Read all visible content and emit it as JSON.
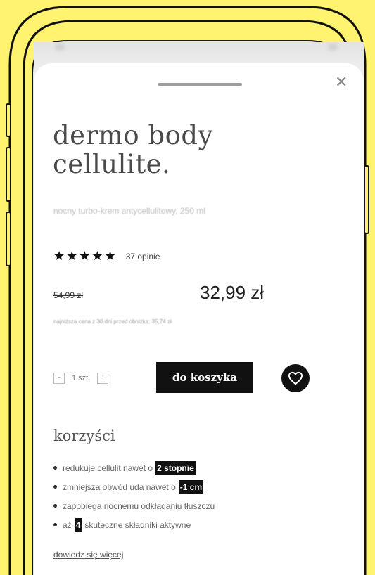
{
  "product": {
    "title_line1": "dermo body",
    "title_line2": "cellulite.",
    "subtitle": "nocny turbo-krem antycellulitowy, 250 ml",
    "stars": "★★★★★",
    "rating_value": 5,
    "reviews": "37 opinie",
    "old_price": "54,99 zł",
    "price": "32,99 zł",
    "lowest_price_note": "najniższa cena z 30 dni przed obniżką: 35,74 zł"
  },
  "quantity": {
    "minus": "-",
    "value": "1 szt.",
    "plus": "+"
  },
  "actions": {
    "add_to_cart": "do koszyka",
    "wishlist_icon": "heart-icon",
    "close_icon": "close-icon"
  },
  "benefits": {
    "title": "korzyści",
    "items": [
      {
        "text": "redukuje cellulit nawet o",
        "highlight": "2 stopnie"
      },
      {
        "text": "zmniejsza obwód uda nawet o",
        "highlight": "-1 cm"
      },
      {
        "text": "zapobiega nocnemu odkładaniu tłuszczu"
      },
      {
        "prefix": "aż",
        "highlight": "4",
        "text": "skuteczne składniki aktywne"
      }
    ],
    "more_link": "dowiedz się więcej"
  },
  "colors": {
    "background": "#FFF36F",
    "frame": "#111111",
    "accent": "#111111"
  }
}
